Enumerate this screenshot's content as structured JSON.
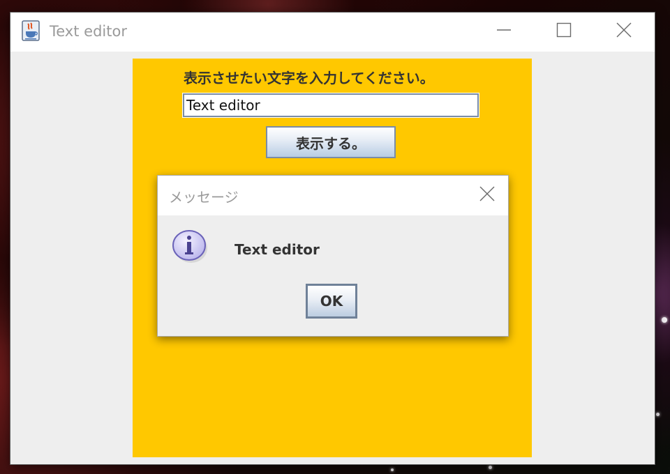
{
  "window": {
    "title": "Text editor",
    "icon": "java-coffee-cup-icon",
    "controls": {
      "minimize_icon": "minimize-icon",
      "maximize_icon": "maximize-icon",
      "close_icon": "close-icon"
    }
  },
  "panel": {
    "background_color": "#ffc800",
    "prompt_label": "表示させたい文字を入力してください。",
    "input_value": "Text editor",
    "show_button_label": "表示する。"
  },
  "dialog": {
    "title": "メッセージ",
    "icon": "info-icon",
    "message": "Text editor",
    "ok_label": "OK"
  }
}
